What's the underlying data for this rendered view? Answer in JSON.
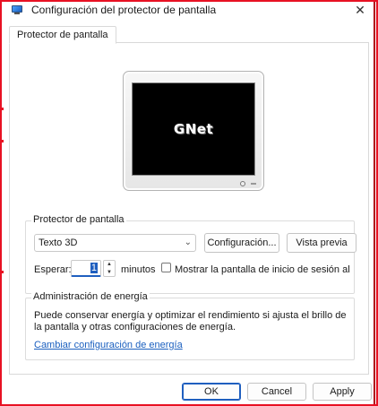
{
  "window": {
    "title": "Configuración del protector de pantalla",
    "close_glyph": "✕"
  },
  "tabs": [
    {
      "label": "Protector de pantalla",
      "active": true
    }
  ],
  "preview": {
    "screen_text": "GNet"
  },
  "screensaver_group": {
    "title": "Protector de pantalla",
    "selected": "Texto 3D",
    "config_button": "Configuración...",
    "preview_button": "Vista previa",
    "wait_label": "Esperar:",
    "wait_value": "1",
    "minutes_label": "minutos",
    "show_logon_label": "Mostrar la pantalla de inicio de sesión al re",
    "show_logon_checked": false
  },
  "power_group": {
    "title": "Administración de energía",
    "description": "Puede conservar energía y optimizar el rendimiento si ajusta el brillo de la pantalla y otras configuraciones de energía.",
    "link": "Cambiar configuración de energía"
  },
  "footer": {
    "ok": "OK",
    "cancel": "Cancel",
    "apply": "Apply"
  },
  "colors": {
    "accent": "#1f5fbf",
    "frame": "#e81123",
    "link": "#1a5fbf"
  }
}
